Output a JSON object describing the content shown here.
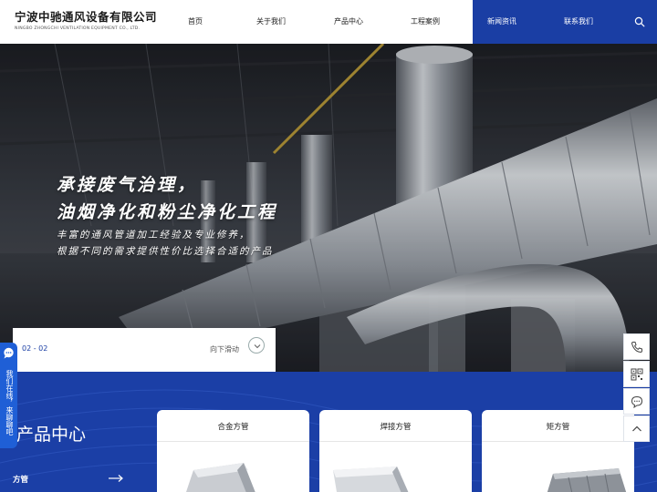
{
  "header": {
    "company_cn": "宁波中驰通风设备有限公司",
    "company_en": "NINGBO ZHONGCHI VENTILATION EQUIPMENT CO., LTD.",
    "nav": [
      "首页",
      "关于我们",
      "产品中心",
      "工程案例",
      "新闻资讯",
      "联系我们"
    ],
    "search_icon": "search-icon"
  },
  "hero": {
    "title_line1": "承接废气治理，",
    "title_line2": "油烟净化和粉尘净化工程",
    "sub_line1": "丰富的通风管道加工经验及专业修养，",
    "sub_line2": "根据不同的需求提供性价比选择合适的产品",
    "slide_counter": "02 - 02",
    "scroll_hint": "向下滑动"
  },
  "left_float": {
    "text": "我们在线，来聊聊吧",
    "icon": "chat-bubble-icon"
  },
  "right_float": [
    "phone-icon",
    "qrcode-icon",
    "message-icon",
    "back-to-top-icon"
  ],
  "products": {
    "section_title": "产品中心",
    "category": "方管",
    "cards": [
      "合金方管",
      "焊接方管",
      "矩方管"
    ]
  },
  "colors": {
    "primary_blue": "#1a3ea4",
    "float_blue": "#1f5fd6"
  }
}
